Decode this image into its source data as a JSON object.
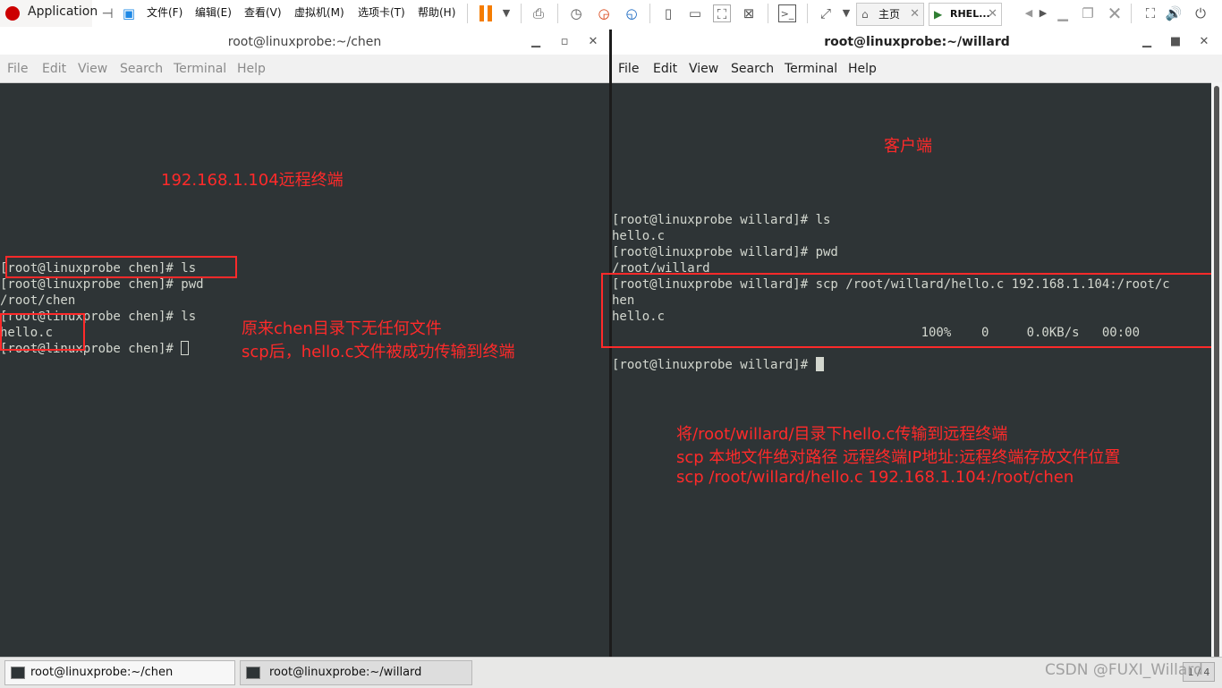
{
  "topbar": {
    "app_menu": "Application",
    "menus": [
      "文件(F)",
      "编辑(E)",
      "查看(V)",
      "虚拟机(M)",
      "选项卡(T)",
      "帮助(H)"
    ],
    "tabs": [
      {
        "label": "主页",
        "close": "✕"
      },
      {
        "label": "RHEL...",
        "close": "✕"
      }
    ]
  },
  "left_window": {
    "title": "root@linuxprobe:~/chen",
    "menu": [
      "File",
      "Edit",
      "View",
      "Search",
      "Terminal",
      "Help"
    ],
    "lines": [
      "[root@linuxprobe chen]# ls",
      "[root@linuxprobe chen]# pwd",
      "/root/chen",
      "[root@linuxprobe chen]# ls",
      "hello.c",
      "[root@linuxprobe chen]# "
    ],
    "annotations": {
      "header": "192.168.1.104远程终端",
      "note1": "原来chen目录下无任何文件",
      "note2": "scp后，hello.c文件被成功传输到终端"
    }
  },
  "right_window": {
    "title": "root@linuxprobe:~/willard",
    "menu": [
      "File",
      "Edit",
      "View",
      "Search",
      "Terminal",
      "Help"
    ],
    "lines": [
      "[root@linuxprobe willard]# ls",
      "hello.c",
      "[root@linuxprobe willard]# pwd",
      "/root/willard",
      "[root@linuxprobe willard]# scp /root/willard/hello.c 192.168.1.104:/root/c",
      "hen",
      "hello.c",
      "                                         100%    0     0.0KB/s   00:00",
      "",
      "[root@linuxprobe willard]# "
    ],
    "annotations": {
      "header": "客户端",
      "note1": "将/root/willard/目录下hello.c传输到远程终端",
      "note2": "scp 本地文件绝对路径  远程终端IP地址:远程终端存放文件位置",
      "note3": "scp /root/willard/hello.c 192.168.1.104:/root/chen"
    }
  },
  "taskbar": {
    "items": [
      "root@linuxprobe:~/chen",
      "root@linuxprobe:~/willard"
    ],
    "watermark": "CSDN @FUXI_Willard",
    "pager": "1 / 4"
  },
  "colors": {
    "annotation": "#ff2a2a",
    "terminal_bg": "#2e3436",
    "terminal_fg": "#d3d7cf"
  }
}
